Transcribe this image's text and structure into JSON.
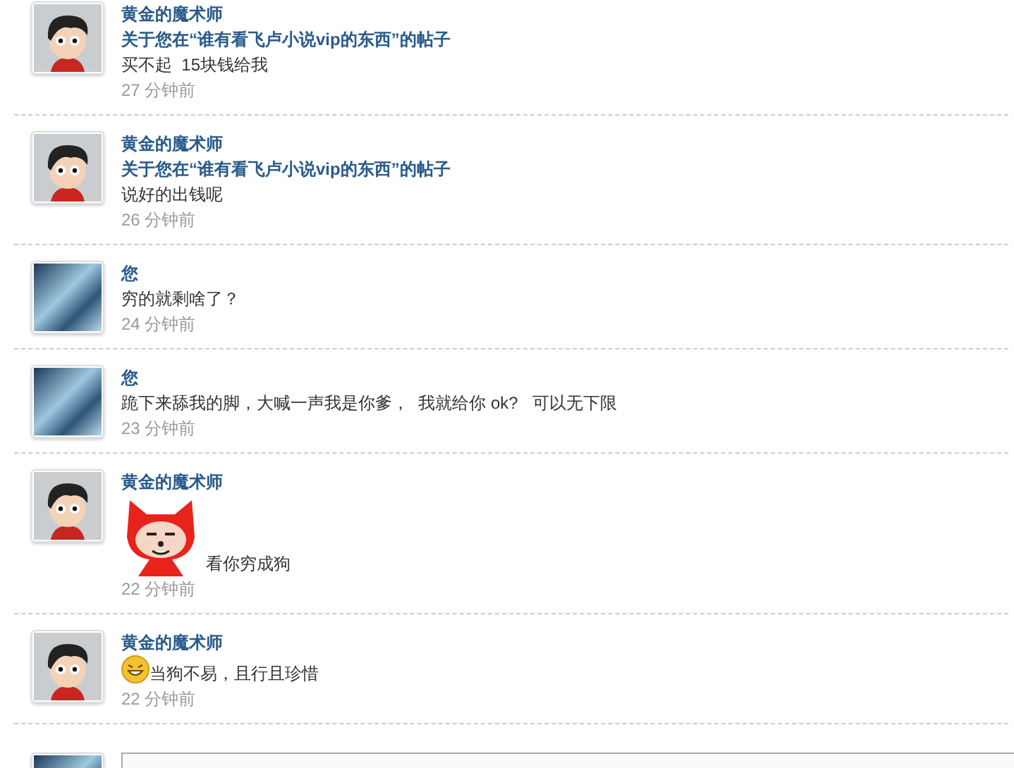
{
  "comments": [
    {
      "avatar": {
        "kind": "cartoon"
      },
      "author": "黄金的魔术师",
      "subject": "关于您在“谁有看飞卢小说vip的东西”的帖子",
      "message": "买不起  15块钱给我",
      "time": "27 分钟前"
    },
    {
      "avatar": {
        "kind": "cartoon"
      },
      "author": "黄金的魔术师",
      "subject": "关于您在“谁有看飞卢小说vip的东西”的帖子",
      "message": "说好的出钱呢",
      "time": "26 分钟前"
    },
    {
      "avatar": {
        "kind": "photo"
      },
      "author": "您",
      "message": "穷的就剩啥了？",
      "time": "24 分钟前"
    },
    {
      "avatar": {
        "kind": "photo"
      },
      "author": "您",
      "message": "跪下来舔我的脚，大喊一声我是你爹，  我就给你 ok?   可以无下限",
      "time": "23 分钟前"
    },
    {
      "avatar": {
        "kind": "cartoon"
      },
      "author": "黄金的魔术师",
      "emoticon": {
        "kind": "sticker"
      },
      "message": "看你穷成狗",
      "time": "22 分钟前"
    },
    {
      "avatar": {
        "kind": "cartoon"
      },
      "author": "黄金的魔术师",
      "emoticon": {
        "kind": "smiley"
      },
      "message": "当狗不易，且行且珍惜",
      "time": "22 分钟前"
    }
  ],
  "composer": {
    "avatar": {
      "kind": "photo"
    }
  }
}
